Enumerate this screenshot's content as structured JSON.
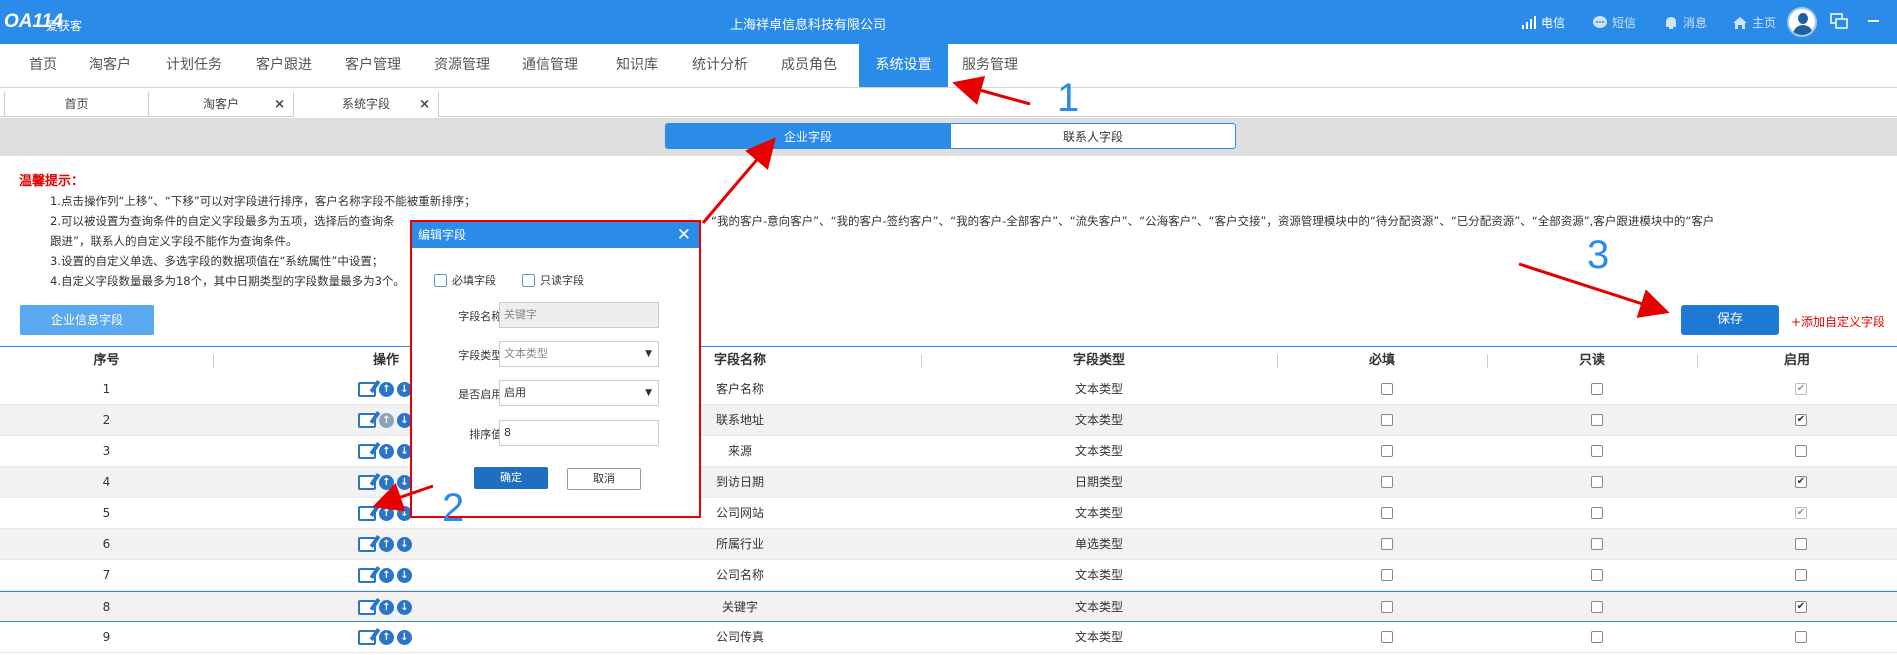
{
  "app": {
    "logo": "OA114",
    "logo_cn": "爱获客",
    "company": "上海祥卓信息科技有限公司"
  },
  "topbar": {
    "signal": "电信",
    "sms": "短信",
    "message": "消息",
    "home": "主页"
  },
  "menu": [
    {
      "label": "首页"
    },
    {
      "label": "淘客户"
    },
    {
      "label": "计划任务"
    },
    {
      "label": "客户跟进"
    },
    {
      "label": "客户管理"
    },
    {
      "label": "资源管理"
    },
    {
      "label": "通信管理"
    },
    {
      "label": "知识库"
    },
    {
      "label": "统计分析"
    },
    {
      "label": "成员角色"
    },
    {
      "label": "系统设置"
    },
    {
      "label": "服务管理"
    }
  ],
  "tabs": [
    {
      "label": "首页"
    },
    {
      "label": "淘客户",
      "close": "×"
    },
    {
      "label": "系统字段",
      "close": "×"
    }
  ],
  "segments": {
    "enterprise": "企业字段",
    "contact": "联系人字段"
  },
  "tips": {
    "title": "温馨提示：",
    "line1": "1.点击操作列“上移”、“下移”可以对字段进行排序，客户名称字段不能被重新排序；",
    "line2_left": "2.可以被设置为查询条件的自定义字段最多为五项，选择后的查询条",
    "line2_right": "“我的客户-意向客户”、“我的客户-签约客户”、“我的客户-全部客户”、“流失客户”、“公海客户”、“客户交接”，资源管理模块中的“待分配资源”、“已分配资源”、“全部资源”,客户跟进模块中的“客户",
    "line2_cont": "跟进”，联系人的自定义字段不能作为查询条件。",
    "line3": "3.设置的自定义单选、多选字段的数据项值在“系统属性”中设置；",
    "line4": "4.自定义字段数量最多为18个，其中日期类型的字段数量最多为3个。"
  },
  "buttons": {
    "info_fields": "企业信息字段",
    "save": "保存",
    "add_custom": "+添加自定义字段"
  },
  "table": {
    "headers": [
      "序号",
      "操作",
      "字段名称",
      "字段类型",
      "必填",
      "只读",
      "启用"
    ],
    "rows": [
      {
        "no": "1",
        "name": "客户名称",
        "type": "文本类型",
        "required": false,
        "readonly": false,
        "enabled": true
      },
      {
        "no": "2",
        "name": "联系地址",
        "type": "文本类型",
        "required": false,
        "readonly": false,
        "enabled": true
      },
      {
        "no": "3",
        "name": "来源",
        "type": "文本类型",
        "required": false,
        "readonly": false,
        "enabled": false
      },
      {
        "no": "4",
        "name": "到访日期",
        "type": "日期类型",
        "required": false,
        "readonly": false,
        "enabled": true
      },
      {
        "no": "5",
        "name": "公司网站",
        "type": "文本类型",
        "required": false,
        "readonly": false,
        "enabled": true
      },
      {
        "no": "6",
        "name": "所属行业",
        "type": "单选类型",
        "required": false,
        "readonly": false,
        "enabled": false
      },
      {
        "no": "7",
        "name": "公司名称",
        "type": "文本类型",
        "required": false,
        "readonly": false,
        "enabled": false
      },
      {
        "no": "8",
        "name": "关键字",
        "type": "文本类型",
        "required": false,
        "readonly": false,
        "enabled": true
      },
      {
        "no": "9",
        "name": "公司传真",
        "type": "文本类型",
        "required": false,
        "readonly": false,
        "enabled": false
      }
    ]
  },
  "dialog": {
    "title": "编辑字段",
    "close": "✕",
    "required_label": "必填字段",
    "readonly_label": "只读字段",
    "name_label": "字段名称:",
    "name_value": "关键字",
    "type_label": "字段类型:",
    "type_value": "文本类型",
    "enabled_label": "是否启用:",
    "enabled_value": "启用",
    "sort_label": "排序值:",
    "sort_value": "8",
    "ok": "确定",
    "cancel": "取消"
  },
  "annotations": [
    "1",
    "2",
    "3"
  ],
  "colors": {
    "primary": "#2b8be8",
    "annotation_red": "#e60000"
  }
}
